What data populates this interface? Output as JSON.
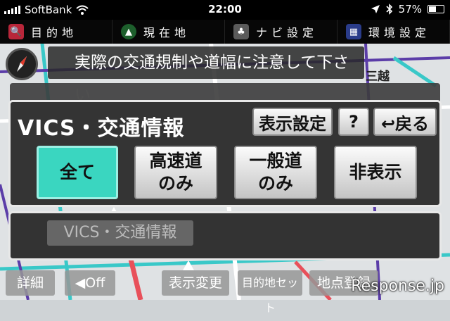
{
  "status": {
    "carrier": "SoftBank",
    "time": "22:00",
    "battery": "57%",
    "battery_level": 0.57
  },
  "menu": [
    {
      "label": "目的地",
      "icon": "search-icon",
      "glyph": "🔍",
      "color": "#b8263a"
    },
    {
      "label": "現在地",
      "icon": "location-arrow-icon",
      "glyph": "▲",
      "color": "#1d5f2c"
    },
    {
      "label": "ナビ設定",
      "icon": "navi-settings-icon",
      "glyph": "♣",
      "color": "#5a5a5a"
    },
    {
      "label": "環境設定",
      "icon": "environment-settings-icon",
      "glyph": "▦",
      "color": "#2a3c8a"
    }
  ],
  "map": {
    "notice": "実際の交通規制や道幅に注意して下さい",
    "labels": [
      "三越",
      "詳細"
    ]
  },
  "panel": {
    "title": "VICS・交通情報",
    "display_settings": "表示設定",
    "help": "?",
    "back": "↩戻る",
    "options": [
      {
        "line1": "全て",
        "line2": "",
        "active": true
      },
      {
        "line1": "高速道",
        "line2": "のみ",
        "active": false
      },
      {
        "line1": "一般道",
        "line2": "のみ",
        "active": false
      },
      {
        "line1": "非表示",
        "line2": "",
        "active": false
      }
    ]
  },
  "lower_panel": {
    "label": "VICS・交通情報"
  },
  "bottom": {
    "detail": "詳細",
    "toggle_off": "◀Off",
    "display_change": "表示変更",
    "destination_set": "目的地セット",
    "point_register": "地点登録",
    "watermark": "Response.jp"
  }
}
